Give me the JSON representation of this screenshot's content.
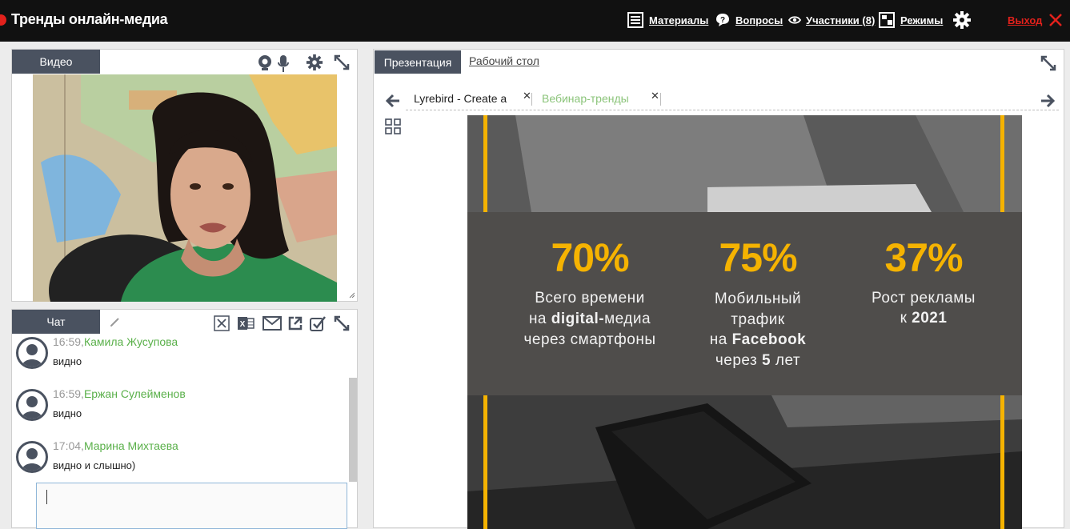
{
  "app": {
    "title": "Тренды онлайн-медиа"
  },
  "nav": {
    "materials": "Материалы",
    "questions": "Вопросы",
    "participants": "Участники (8)",
    "modes": "Режимы",
    "exit": "Выход"
  },
  "video": {
    "tab": "Видео"
  },
  "chat": {
    "tab": "Чат",
    "messages": [
      {
        "time": "16:59,",
        "author": "Камила Жусупова",
        "text": "видно"
      },
      {
        "time": "16:59,",
        "author": "Ержан Сулейменов",
        "text": "видно"
      },
      {
        "time": "17:04,",
        "author": "Марина Михтаева",
        "text": "видно и слышно)"
      }
    ]
  },
  "presentation": {
    "tab_active": "Презентация",
    "tab_desktop": "Рабочий стол",
    "doc_tabs": [
      {
        "label": "Lyrebird - Create a"
      },
      {
        "label": "Вебинар-тренды"
      }
    ],
    "slide": {
      "stats": [
        {
          "pct": "70%",
          "line1": "Всего времени",
          "line2_pre": "на ",
          "line2_bold": "digital-",
          "line2_post": "медиа",
          "line3": "через смартфоны"
        },
        {
          "pct": "75%",
          "line1": "Мобильный",
          "line2": "трафик",
          "line3_pre": "на ",
          "line3_bold": "Facebook",
          "line4_pre": "через ",
          "line4_bold": "5",
          "line4_post": " лет"
        },
        {
          "pct": "37%",
          "line1": "Рост рекламы",
          "line2_pre": "к ",
          "line2_bold": "2021"
        }
      ]
    }
  },
  "colors": {
    "accent_red": "#e2211c",
    "slide_yellow": "#f5b301",
    "author_green": "#5ab04a",
    "tab_dark": "#4a5260"
  }
}
